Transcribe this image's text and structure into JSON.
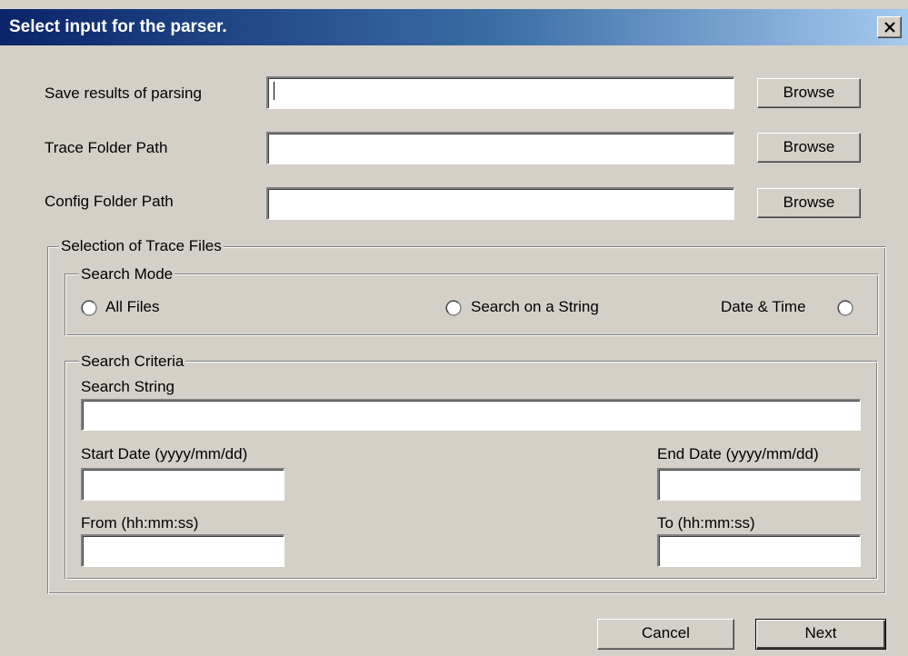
{
  "window": {
    "title": "Select input for the parser."
  },
  "fields": {
    "save_results": {
      "label": "Save results of parsing",
      "value": "",
      "browse_label": "Browse"
    },
    "trace_folder": {
      "label": "Trace Folder Path",
      "value": "",
      "browse_label": "Browse"
    },
    "config_folder": {
      "label": "Config Folder Path",
      "value": "",
      "browse_label": "Browse"
    }
  },
  "selection_group": {
    "legend": "Selection of Trace Files",
    "search_mode": {
      "legend": "Search Mode",
      "options": [
        {
          "label": "All Files",
          "selected": false
        },
        {
          "label": "Search on a String",
          "selected": false
        },
        {
          "label": "Date & Time",
          "selected": false
        }
      ]
    },
    "search_criteria": {
      "legend": "Search Criteria",
      "search_string_label": "Search String",
      "search_string_value": "",
      "start_date_label": "Start Date (yyyy/mm/dd)",
      "start_date_value": "",
      "end_date_label": "End Date (yyyy/mm/dd)",
      "end_date_value": "",
      "from_label": "From (hh:mm:ss)",
      "from_value": "",
      "to_label": "To (hh:mm:ss)",
      "to_value": ""
    }
  },
  "actions": {
    "cancel_label": "Cancel",
    "next_label": "Next"
  }
}
